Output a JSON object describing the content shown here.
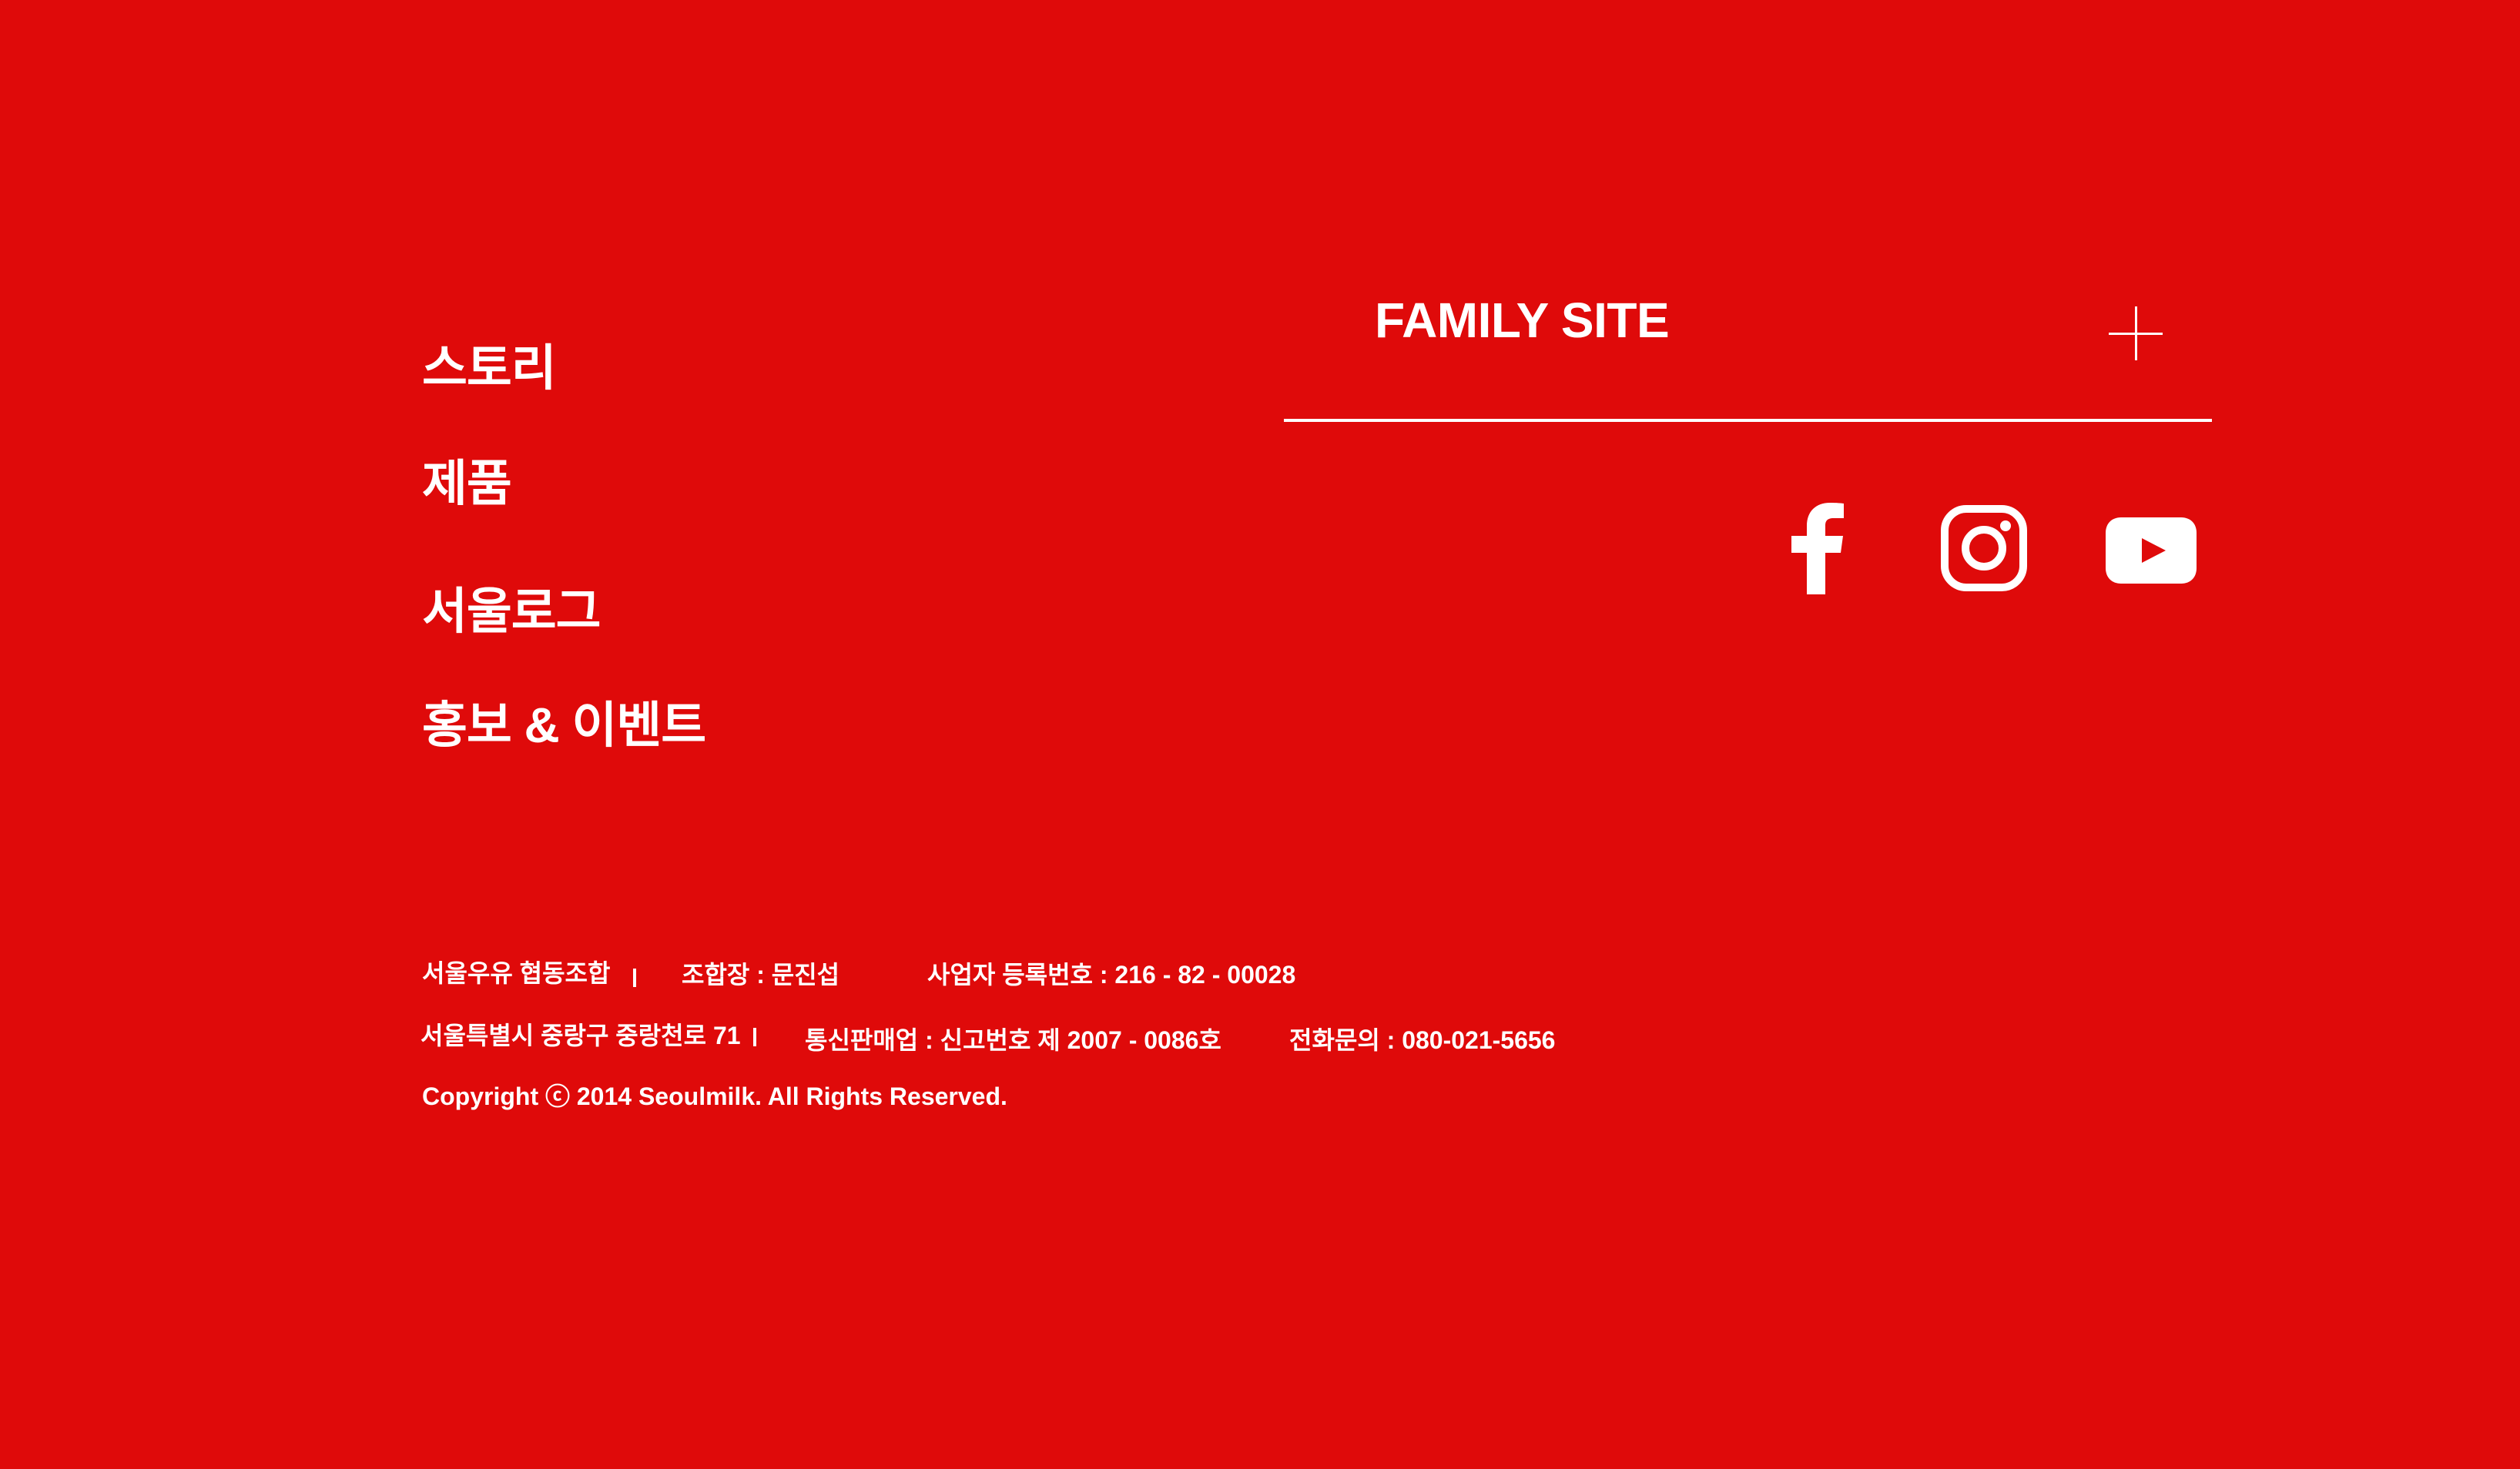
{
  "colors": {
    "background": "#df0a0a",
    "foreground": "#ffffff"
  },
  "nav": {
    "items": [
      {
        "label": "스토리"
      },
      {
        "label": "제품"
      },
      {
        "label": "서울로그"
      },
      {
        "label": "홍보 & 이벤트"
      }
    ]
  },
  "family_site": {
    "label": "FAMILY SITE",
    "toggle_icon": "plus-icon"
  },
  "social": {
    "items": [
      {
        "icon": "facebook-icon"
      },
      {
        "icon": "instagram-icon"
      },
      {
        "icon": "youtube-icon"
      }
    ]
  },
  "footer": {
    "company": "서울우유 협동조합",
    "chairman": "조합장 : 문진섭",
    "business_reg": "사업자 등록번호 : 216 - 82 - 00028",
    "address": "서울특별시 중랑구 중랑천로 71",
    "mail_order": "통신판매업 : 신고번호 제 2007 - 0086호",
    "phone": "전화문의 : 080-021-5656",
    "copyright": "Copyright ⓒ 2014 Seoulmilk. All Rights Reserved."
  }
}
